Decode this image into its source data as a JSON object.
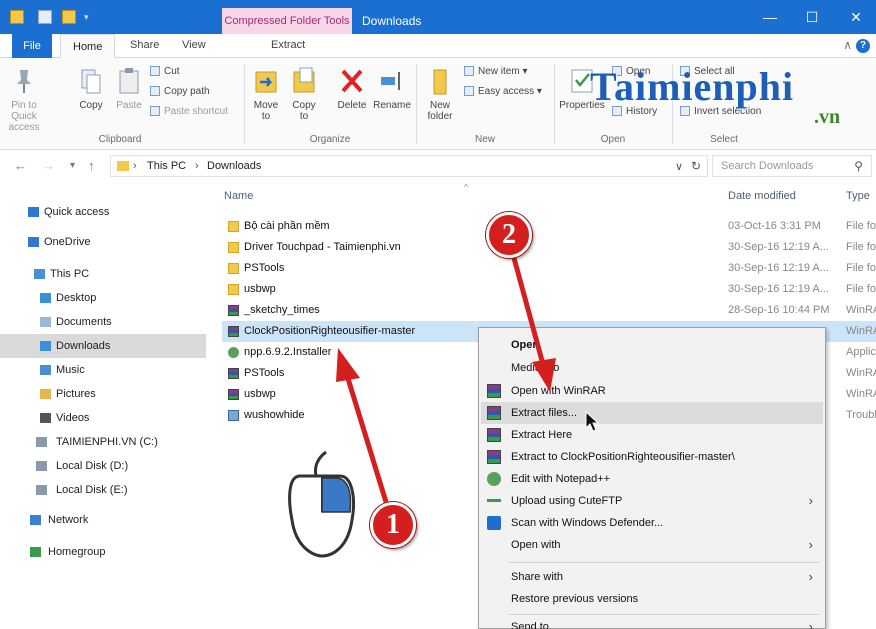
{
  "window": {
    "contextual_tab": "Compressed Folder Tools",
    "title": "Downloads",
    "controls": {
      "minimize": "—",
      "maximize": "☐",
      "close": "✕"
    }
  },
  "ribbon_tabs": {
    "file": "File",
    "home": "Home",
    "share": "Share",
    "view": "View",
    "extract": "Extract"
  },
  "ribbon": {
    "clipboard": {
      "pin": "Pin to Quick access",
      "copy": "Copy",
      "paste": "Paste",
      "cut": "Cut",
      "copy_path": "Copy path",
      "paste_shortcut": "Paste shortcut",
      "label": "Clipboard"
    },
    "organize": {
      "move_to": "Move to",
      "copy_to": "Copy to",
      "delete": "Delete",
      "rename": "Rename",
      "label": "Organize"
    },
    "new": {
      "new_folder": "New folder",
      "new_item": "New item",
      "easy_access": "Easy access",
      "label": "New"
    },
    "open": {
      "properties": "Properties",
      "open": "Open",
      "history": "History",
      "label": "Open"
    },
    "select": {
      "select_all": "Select all",
      "invert_selection": "Invert selection",
      "label": "Select"
    }
  },
  "watermark": {
    "main": "Taimienphi",
    "suffix": ".vn"
  },
  "address": {
    "crumbs": [
      "This PC",
      "Downloads"
    ],
    "search_placeholder": "Search Downloads"
  },
  "nav": [
    {
      "label": "Quick access",
      "icon": "star-icon",
      "color": "#2f78d0"
    },
    {
      "label": "OneDrive",
      "icon": "cloud-icon",
      "color": "#2f78d0"
    },
    {
      "label": "This PC",
      "icon": "computer-icon",
      "color": "#4a90d9"
    },
    {
      "label": "Desktop",
      "icon": "desktop-icon",
      "color": "#3a8fd6"
    },
    {
      "label": "Documents",
      "icon": "documents-icon",
      "color": "#9bb6d6"
    },
    {
      "label": "Downloads",
      "icon": "downloads-icon",
      "color": "#3a8fd6"
    },
    {
      "label": "Music",
      "icon": "music-icon",
      "color": "#4a8fd6"
    },
    {
      "label": "Pictures",
      "icon": "pictures-icon",
      "color": "#e8b54a"
    },
    {
      "label": "Videos",
      "icon": "videos-icon",
      "color": "#555555"
    },
    {
      "label": "TAIMIENPHI.VN (C:)",
      "icon": "drive-icon",
      "color": "#8a9aaa"
    },
    {
      "label": "Local Disk (D:)",
      "icon": "drive-icon",
      "color": "#8a9aaa"
    },
    {
      "label": "Local Disk (E:)",
      "icon": "drive-icon",
      "color": "#8a9aaa"
    },
    {
      "label": "Network",
      "icon": "network-icon",
      "color": "#3a7fd0"
    },
    {
      "label": "Homegroup",
      "icon": "homegroup-icon",
      "color": "#3a9a4a"
    }
  ],
  "columns": {
    "name": "Name",
    "date": "Date modified",
    "type": "Type"
  },
  "files": [
    {
      "name": "Bộ cài phần mềm",
      "date": "03-Oct-16 3:31 PM",
      "type": "File fo",
      "kind": "folder"
    },
    {
      "name": "Driver Touchpad - Taimienphi.vn",
      "date": "30-Sep-16 12:19 A...",
      "type": "File fo",
      "kind": "folder"
    },
    {
      "name": "PSTools",
      "date": "30-Sep-16 12:19 A...",
      "type": "File fo",
      "kind": "folder"
    },
    {
      "name": "usbwp",
      "date": "30-Sep-16 12:19 A...",
      "type": "File fo",
      "kind": "folder"
    },
    {
      "name": "_sketchy_times",
      "date": "28-Sep-16 10:44 PM",
      "type": "WinRA",
      "kind": "rar"
    },
    {
      "name": "ClockPositionRighteousifier-master",
      "date": "",
      "type": "WinRA",
      "kind": "rar"
    },
    {
      "name": "npp.6.9.2.Installer",
      "date": "",
      "type": "Applic",
      "kind": "app"
    },
    {
      "name": "PSTools",
      "date": "",
      "type": "WinRA",
      "kind": "rar"
    },
    {
      "name": "usbwp",
      "date": "",
      "type": "WinRA",
      "kind": "rar"
    },
    {
      "name": "wushowhide",
      "date": "",
      "type": "Troubl",
      "kind": "setup"
    }
  ],
  "context_menu": {
    "open": "Open",
    "media_info": "MediaInfo",
    "open_with_winrar": "Open with WinRAR",
    "extract_files": "Extract files...",
    "extract_here": "Extract Here",
    "extract_to": "Extract to ClockPositionRighteousifier-master\\",
    "edit_npp": "Edit with Notepad++",
    "upload_cuteftp": "Upload using CuteFTP",
    "scan_defender": "Scan with Windows Defender...",
    "open_with": "Open with",
    "share_with": "Share with",
    "restore_versions": "Restore previous versions",
    "send_to": "Send to"
  },
  "annotations": {
    "step1": "1",
    "step2": "2",
    "arrow_color": "#d51f1f"
  }
}
